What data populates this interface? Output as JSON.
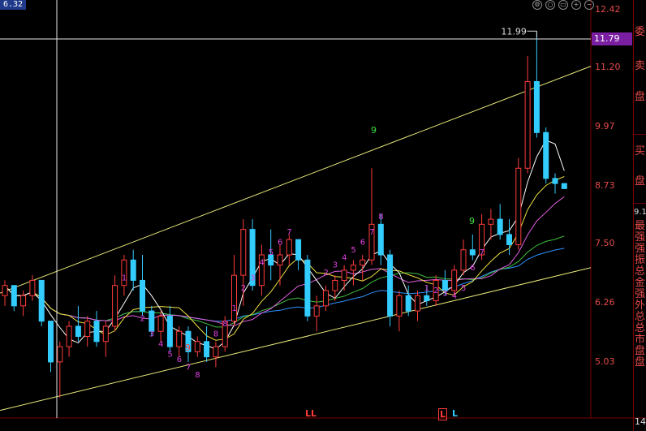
{
  "header": {
    "top_left_price": "6.32"
  },
  "axis": {
    "ticks": [
      "12.42",
      "11.20",
      "9.97",
      "8.73",
      "7.50",
      "6.26",
      "5.03"
    ],
    "current_price_tag": "11.79",
    "high_marker": "11.99"
  },
  "side_panel": {
    "label_1": "委",
    "label_2": "卖",
    "label_3": "盘",
    "label_4": "买",
    "label_5": "盘",
    "value": "9.1",
    "vertical_text": "最强强振总金强外总总市盘盘",
    "bottom_value": "14"
  },
  "time_markers": [
    {
      "text": "LL",
      "color": "#ff3b3b"
    },
    {
      "text": "L",
      "color": "#ff3b3b"
    },
    {
      "text": "L",
      "color": "#33ccff"
    }
  ],
  "sequence_labels": {
    "magenta": [
      "1",
      "2",
      "3",
      "4",
      "5",
      "6",
      "7",
      "8",
      "2",
      "3",
      "4",
      "5",
      "6",
      "7",
      "8",
      "1",
      "2",
      "3",
      "4",
      "5",
      "6",
      "7",
      "8",
      "1",
      "2",
      "3",
      "4",
      "5",
      "6",
      "7",
      "8"
    ],
    "red": [
      "9"
    ],
    "green": [
      "9",
      "9"
    ]
  },
  "colors": {
    "up": "#ff3b3b",
    "down": "#33ccff",
    "channel": "#e8e878",
    "ma5": "#ffffff",
    "ma10": "#f0e040",
    "ma20": "#e060e0",
    "ma30": "#40c040",
    "ma60": "#3090ff",
    "crosshair": "#e6e6e6"
  },
  "chart_data": {
    "type": "candlestick",
    "y_range": [
      4.4,
      12.6
    ],
    "x_count": 62,
    "ohlc": [
      [
        6.8,
        7.1,
        6.6,
        7.0
      ],
      [
        7.0,
        7.0,
        6.5,
        6.6
      ],
      [
        6.6,
        6.9,
        6.4,
        6.8
      ],
      [
        6.8,
        7.2,
        6.7,
        7.1
      ],
      [
        7.1,
        7.1,
        6.2,
        6.3
      ],
      [
        6.3,
        6.3,
        5.3,
        5.5
      ],
      [
        5.5,
        5.9,
        4.8,
        5.8
      ],
      [
        5.8,
        6.3,
        5.6,
        6.2
      ],
      [
        6.2,
        6.6,
        5.9,
        6.0
      ],
      [
        6.0,
        6.4,
        5.8,
        6.3
      ],
      [
        6.3,
        6.5,
        5.8,
        5.9
      ],
      [
        5.9,
        6.3,
        5.6,
        6.2
      ],
      [
        6.2,
        7.2,
        6.1,
        7.0
      ],
      [
        7.0,
        7.6,
        6.8,
        7.5
      ],
      [
        7.5,
        7.7,
        6.9,
        7.1
      ],
      [
        7.1,
        7.6,
        6.4,
        6.5
      ],
      [
        6.5,
        6.6,
        6.0,
        6.1
      ],
      [
        6.1,
        6.5,
        5.9,
        6.4
      ],
      [
        6.4,
        6.6,
        5.7,
        5.8
      ],
      [
        5.8,
        6.2,
        5.6,
        6.1
      ],
      [
        6.1,
        6.2,
        5.5,
        5.7
      ],
      [
        5.7,
        6.0,
        5.6,
        5.9
      ],
      [
        5.9,
        6.2,
        5.5,
        5.6
      ],
      [
        5.6,
        5.9,
        5.4,
        5.8
      ],
      [
        5.8,
        6.4,
        5.7,
        6.3
      ],
      [
        6.3,
        7.6,
        6.2,
        7.2
      ],
      [
        7.2,
        8.3,
        6.6,
        8.1
      ],
      [
        8.1,
        8.3,
        6.9,
        7.0
      ],
      [
        7.0,
        7.8,
        6.8,
        7.6
      ],
      [
        7.6,
        8.1,
        7.1,
        7.4
      ],
      [
        7.4,
        7.8,
        7.0,
        7.6
      ],
      [
        7.6,
        8.0,
        7.4,
        7.9
      ],
      [
        7.9,
        7.9,
        7.3,
        7.5
      ],
      [
        7.5,
        7.6,
        6.3,
        6.4
      ],
      [
        6.4,
        6.8,
        6.1,
        6.6
      ],
      [
        6.6,
        7.0,
        6.5,
        6.9
      ],
      [
        6.9,
        7.2,
        6.7,
        7.1
      ],
      [
        7.1,
        7.4,
        6.9,
        7.3
      ],
      [
        7.3,
        7.5,
        7.0,
        7.4
      ],
      [
        7.4,
        7.6,
        7.1,
        7.5
      ],
      [
        7.5,
        9.3,
        7.4,
        8.2
      ],
      [
        8.2,
        8.4,
        7.4,
        7.6
      ],
      [
        7.6,
        7.7,
        6.2,
        6.4
      ],
      [
        6.4,
        6.9,
        6.1,
        6.8
      ],
      [
        6.8,
        7.0,
        6.4,
        6.5
      ],
      [
        6.5,
        6.9,
        6.3,
        6.8
      ],
      [
        6.8,
        7.0,
        6.6,
        6.7
      ],
      [
        6.7,
        7.2,
        6.6,
        7.1
      ],
      [
        7.1,
        7.3,
        6.8,
        6.9
      ],
      [
        6.9,
        7.4,
        6.8,
        7.3
      ],
      [
        7.3,
        7.9,
        7.2,
        7.7
      ],
      [
        7.7,
        8.0,
        7.5,
        7.6
      ],
      [
        7.6,
        8.4,
        7.5,
        8.2
      ],
      [
        8.2,
        8.5,
        7.9,
        8.3
      ],
      [
        8.3,
        8.6,
        7.9,
        8.0
      ],
      [
        8.0,
        8.3,
        7.6,
        7.8
      ],
      [
        7.8,
        9.5,
        7.7,
        9.3
      ],
      [
        9.3,
        11.5,
        9.2,
        11.0
      ],
      [
        11.0,
        11.99,
        9.9,
        10.0
      ],
      [
        10.0,
        10.1,
        9.0,
        9.1
      ],
      [
        9.1,
        9.2,
        8.8,
        9.0
      ],
      [
        9.0,
        9.0,
        8.9,
        8.9
      ]
    ]
  }
}
